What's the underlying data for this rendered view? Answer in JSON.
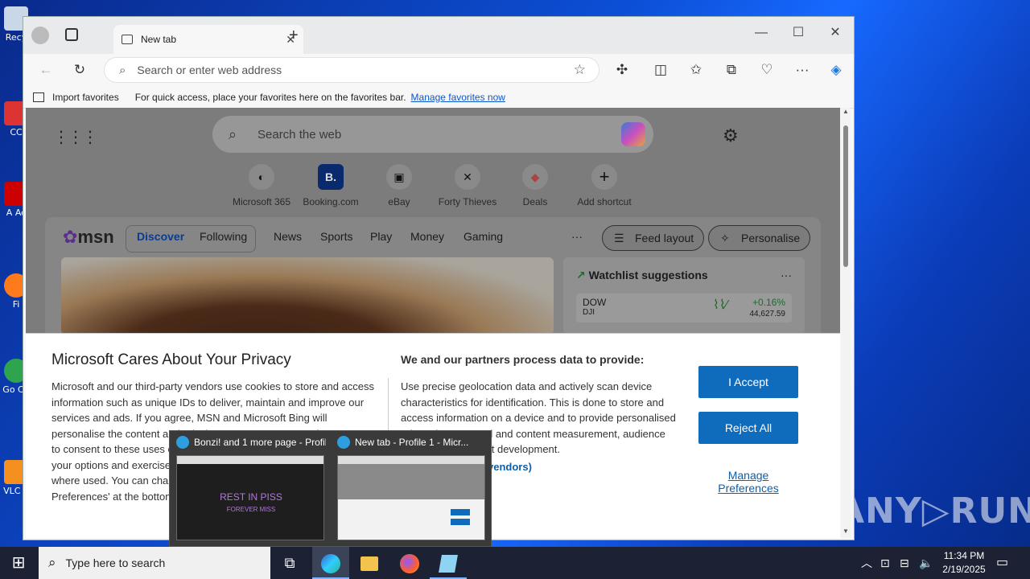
{
  "desktop": {
    "icons": [
      "Recy",
      "CC",
      "A Ac",
      "Fi",
      "Go Ch",
      "VLC p"
    ],
    "watermark": "ANY▷RUN"
  },
  "browser": {
    "tab_title": "New tab",
    "address_placeholder": "Search or enter web address",
    "favorites_bar": {
      "import_label": "Import favorites",
      "hint": "For quick access, place your favorites here on the favorites bar.",
      "manage_link": "Manage favorites now"
    }
  },
  "newtab": {
    "search_placeholder": "Search the web",
    "shortcuts": [
      {
        "label": "Microsoft 365",
        "glyph": "◐"
      },
      {
        "label": "Booking.com",
        "glyph": "B."
      },
      {
        "label": "eBay",
        "glyph": "▣"
      },
      {
        "label": "Forty Thieves",
        "glyph": "✕"
      },
      {
        "label": "Deals",
        "glyph": "◆"
      },
      {
        "label": "Add shortcut",
        "glyph": "+"
      }
    ],
    "msn": {
      "logo": "msn",
      "tabs": [
        "Discover",
        "Following"
      ],
      "nav": [
        "News",
        "Sports",
        "Play",
        "Money",
        "Gaming"
      ],
      "more": "···",
      "feed_layout": "Feed layout",
      "personalise": "Personalise",
      "watchlist": {
        "title": "Watchlist suggestions",
        "symbol": "DOW",
        "sub": "DJI",
        "change": "+0.16%",
        "value": "44,627.59"
      }
    }
  },
  "privacy": {
    "title": "Microsoft Cares About Your Privacy",
    "left_text": "Microsoft and our third-party vendors use cookies to store and access information such as unique IDs to deliver, maintain and improve our services and ads. If you agree, MSN and Microsoft Bing will personalise the content and ads that you see. You can select 'I Accept' to consent to these uses or click on 'Manage preferences' to review your options and exercise your right to object to Legitimate Interest where used. You can change your selection under 'Manage Preferences' at the bottom of this page. Number of Partners (vendors)",
    "right_title": "We and our partners process data to provide:",
    "right_text": "Use precise geolocation data and actively scan device characteristics for identification. This is done to store and access information on a device and to provide personalised ads and content, ad and content measurement, audience insights and product development.",
    "vendors_link": "vendors)",
    "accept": "I Accept",
    "reject": "Reject All",
    "manage": "Manage Preferences"
  },
  "thumbnails": [
    {
      "title": "Bonzi! and 1 more page - Profil...",
      "preview_line1": "REST IN PISS",
      "preview_line2": "FOREVER MISS"
    },
    {
      "title": "New tab - Profile 1 - Micr..."
    }
  ],
  "taskbar": {
    "search_placeholder": "Type here to search",
    "time": "11:34 PM",
    "date": "2/19/2025"
  }
}
